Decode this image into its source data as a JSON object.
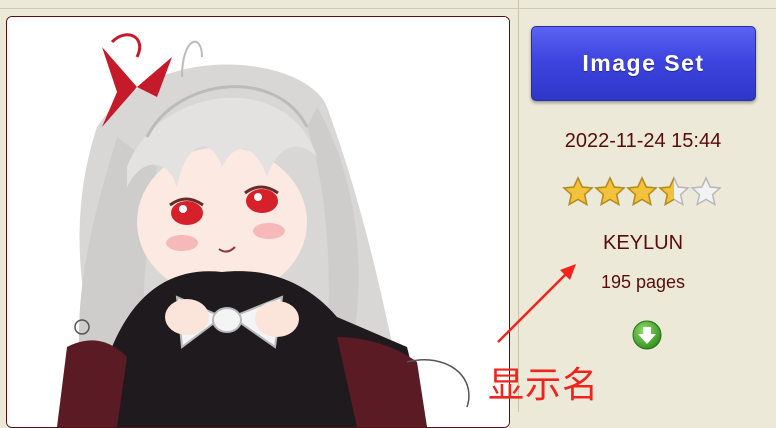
{
  "gallery": {
    "button_label": "Image Set",
    "posted": "2022-11-24 15:44",
    "rating": {
      "value": 3.5,
      "max": 5
    },
    "uploader": "KEYLUN",
    "pages": "195 pages",
    "download_icon": "green-down-arrow-icon"
  },
  "annotation": {
    "text": "显示名",
    "color": "#f0241c"
  },
  "colors": {
    "text": "#5a0c0c",
    "button": "#3e45e0",
    "background": "#ece9d8"
  }
}
